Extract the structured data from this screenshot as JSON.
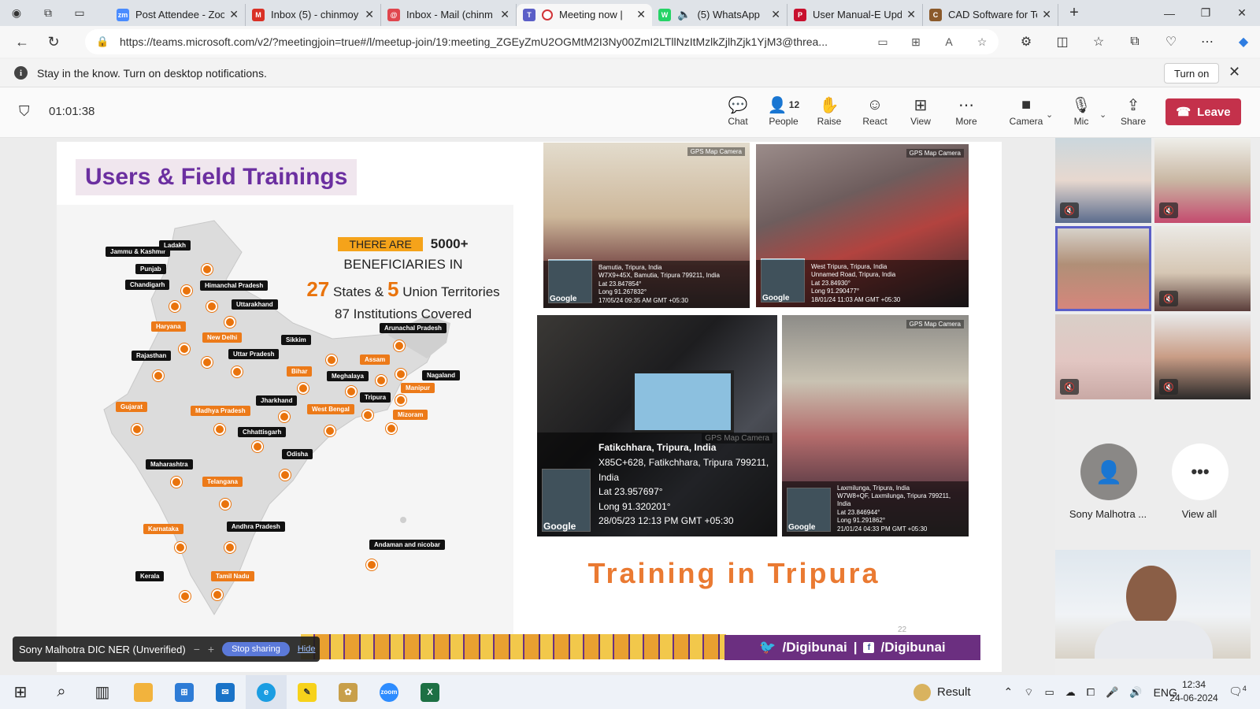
{
  "browser": {
    "tabs": [
      {
        "label": "Post Attendee - Zoo",
        "icon": "zoom-icon",
        "color": "#4a8cff",
        "glyph": "zm"
      },
      {
        "label": "Inbox (5) - chinmoy",
        "icon": "gmail-icon",
        "color": "#d93025",
        "glyph": "M"
      },
      {
        "label": "Inbox - Mail (chinm",
        "icon": "mail-icon",
        "color": "#e0464e",
        "glyph": "@"
      },
      {
        "label": "Meeting now |",
        "icon": "teams-icon",
        "color": "#5b5fc7",
        "glyph": "T"
      },
      {
        "label": "(5) WhatsApp",
        "icon": "whatsapp-icon",
        "color": "#25d366",
        "glyph": "W"
      },
      {
        "label": "User Manual-E Upd",
        "icon": "pdf-icon",
        "color": "#c8102e",
        "glyph": "P"
      },
      {
        "label": "CAD Software for Te",
        "icon": "cad-icon",
        "color": "#8b5a2b",
        "glyph": "C"
      }
    ],
    "url": "https://teams.microsoft.com/v2/?meetingjoin=true#/l/meetup-join/19:meeting_ZGEyZmU2OGMtM2I3Ny00ZmI2LTllNzItMzlkZjlhZjk1YjM3@threa..."
  },
  "notification": {
    "text": "Stay in the know. Turn on desktop notifications.",
    "button": "Turn on"
  },
  "meeting": {
    "timer": "01:01:38",
    "toolbar": [
      {
        "label": "Chat",
        "icon": "chat-icon"
      },
      {
        "label": "People",
        "icon": "people-icon",
        "count": "12"
      },
      {
        "label": "Raise",
        "icon": "raise-hand-icon"
      },
      {
        "label": "React",
        "icon": "react-icon"
      },
      {
        "label": "View",
        "icon": "view-icon"
      },
      {
        "label": "More",
        "icon": "more-icon"
      },
      {
        "label": "Camera",
        "icon": "camera-icon"
      },
      {
        "label": "Mic",
        "icon": "mic-off-icon"
      },
      {
        "label": "Share",
        "icon": "share-icon"
      }
    ],
    "leave": "Leave"
  },
  "slide": {
    "title": "Users & Field Trainings",
    "stats": {
      "badge": "THERE ARE",
      "count": "5000+",
      "line2": "BENEFICIARIES IN",
      "states_num": "27",
      "states_txt": "States &",
      "ut_num": "5",
      "ut_txt": "Union Territories",
      "institutions": "87 Institutions Covered"
    },
    "map_labels": [
      {
        "text": "Jammu & Kashmir",
        "style": "blk"
      },
      {
        "text": "Ladakh",
        "style": "blk"
      },
      {
        "text": "Punjab",
        "style": "blk"
      },
      {
        "text": "Chandigarh",
        "style": "blk"
      },
      {
        "text": "Himanchal Pradesh",
        "style": "blk"
      },
      {
        "text": "Uttarakhand",
        "style": "blk"
      },
      {
        "text": "Haryana",
        "style": "org"
      },
      {
        "text": "New Delhi",
        "style": "org"
      },
      {
        "text": "Rajasthan",
        "style": "blk"
      },
      {
        "text": "Uttar Pradesh",
        "style": "blk"
      },
      {
        "text": "Sikkim",
        "style": "blk"
      },
      {
        "text": "Arunachal Pradesh",
        "style": "blk"
      },
      {
        "text": "Assam",
        "style": "org"
      },
      {
        "text": "Bihar",
        "style": "org"
      },
      {
        "text": "Meghalaya",
        "style": "blk"
      },
      {
        "text": "Nagaland",
        "style": "blk"
      },
      {
        "text": "Manipur",
        "style": "org"
      },
      {
        "text": "Tripura",
        "style": "blk"
      },
      {
        "text": "Mizoram",
        "style": "org"
      },
      {
        "text": "Gujarat",
        "style": "org"
      },
      {
        "text": "Madhya Pradesh",
        "style": "org"
      },
      {
        "text": "Jharkhand",
        "style": "blk"
      },
      {
        "text": "West Bengal",
        "style": "org"
      },
      {
        "text": "Chhattisgarh",
        "style": "blk"
      },
      {
        "text": "Odisha",
        "style": "blk"
      },
      {
        "text": "Maharashtra",
        "style": "blk"
      },
      {
        "text": "Telangana",
        "style": "org"
      },
      {
        "text": "Karnataka",
        "style": "org"
      },
      {
        "text": "Andhra Pradesh",
        "style": "blk"
      },
      {
        "text": "Andaman and nicobar",
        "style": "blk"
      },
      {
        "text": "Kerala",
        "style": "blk"
      },
      {
        "text": "Tamil Nadu",
        "style": "org"
      }
    ],
    "photos": [
      {
        "lines": [
          "Bamutia, Tripura, India",
          "W7X9+45X, Bamutia, Tripura 799211, India",
          "Lat 23.847854°",
          "Long 91.267832°",
          "17/05/24 09:35 AM GMT +05:30"
        ]
      },
      {
        "lines": [
          "West Tripura, Tripura, India",
          "Unnamed Road, Tripura, India",
          "Lat 23.84930°",
          "Long 91.290477°",
          "18/01/24 11:03 AM GMT +05:30"
        ]
      },
      {
        "lines": [
          "Fatikchhara, Tripura, India",
          "X85C+628, Fatikchhara, Tripura 799211, India",
          "Lat 23.957697°",
          "Long 91.320201°",
          "28/05/23 12:13 PM GMT +05:30"
        ]
      },
      {
        "lines": [
          "Laxmilunga, Tripura, India",
          "W7W8+QF, Laxmilunga, Tripura 799211, India",
          "Lat 23.846944°",
          "Long 91.291862°",
          "21/01/24 04:33 PM GMT +05:30"
        ]
      }
    ],
    "gps_camera": "GPS Map Camera",
    "google": "Google",
    "caption": "Training in Tripura",
    "social": {
      "twitter": "/Digibunai",
      "sep": "|",
      "facebook": "/Digibunai"
    },
    "page_num": "22"
  },
  "share_bar": {
    "presenter": "Sony Malhotra DIC NER (Unverified)",
    "stop": "Stop sharing",
    "hide": "Hide"
  },
  "participants": {
    "avatar_name": "Sony Malhotra ...",
    "view_all": "View all"
  },
  "taskbar": {
    "weather": "Result",
    "lang": "ENG",
    "time": "12:34",
    "date": "24-06-2024",
    "notif_count": "4"
  }
}
